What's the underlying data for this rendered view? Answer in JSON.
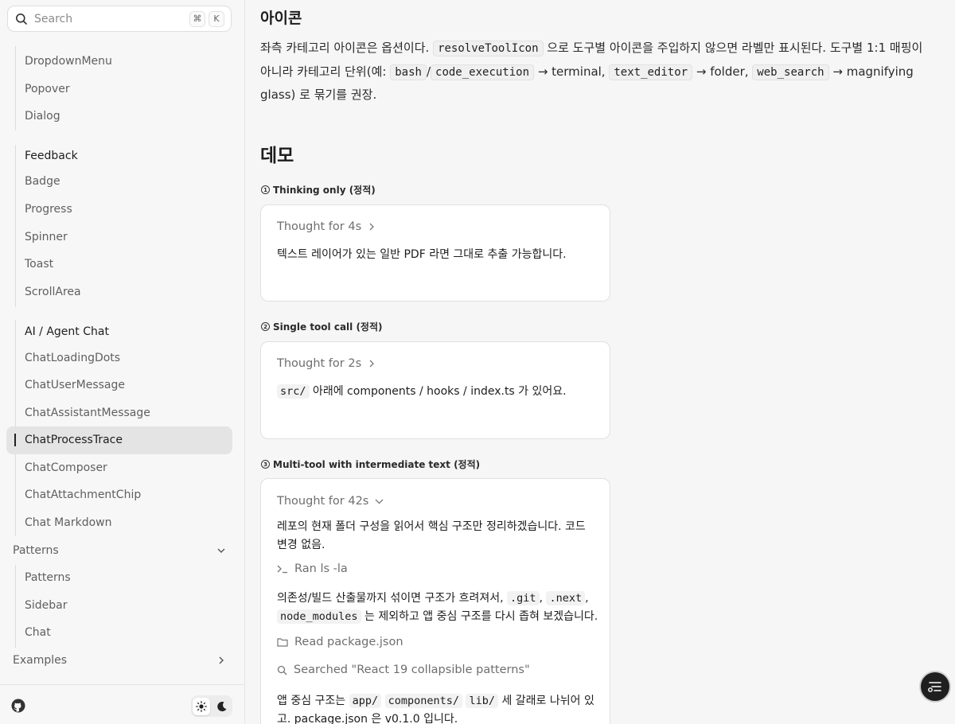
{
  "search": {
    "label": "Search",
    "shortcut_mod": "⌘",
    "shortcut_key": "K"
  },
  "sidebar": {
    "overlays": [
      "DropdownMenu",
      "Popover",
      "Dialog"
    ],
    "feedback_title": "Feedback",
    "feedback": [
      "Badge",
      "Progress",
      "Spinner",
      "Toast",
      "ScrollArea"
    ],
    "ai_title": "AI / Agent Chat",
    "ai": [
      "ChatLoadingDots",
      "ChatUserMessage",
      "ChatAssistantMessage",
      "ChatProcessTrace",
      "ChatComposer",
      "ChatAttachmentChip",
      "Chat Markdown"
    ],
    "patterns_title": "Patterns",
    "patterns": [
      "Patterns",
      "Sidebar",
      "Chat"
    ],
    "examples_title": "Examples"
  },
  "icons_section": {
    "title": "아이콘",
    "p1": "좌측 카테고리 아이콘은 옵션이다.",
    "c1": "resolveToolIcon",
    "p2": "으로 도구별 아이콘을 주입하지 않으면 라벨만 표시된다. 도구별 1:1 매핑이 아니라 카테고리 단위(예:",
    "c2": "bash",
    "slash": "/",
    "c3": "code_execution",
    "p3": "→ terminal,",
    "c4": "text_editor",
    "p4": "→ folder,",
    "c5": "web_search",
    "p5": "→ magnifying glass) 로 묶기를 권장."
  },
  "demo": {
    "title": "데모",
    "d1": {
      "num": "1",
      "label": "Thinking only (정적)",
      "thought": "Thought for 4s",
      "text": "텍스트 레이어가 있는 일반 PDF 라면 그대로 추출 가능합니다."
    },
    "d2": {
      "num": "2",
      "label": "Single tool call (정적)",
      "thought": "Thought for 2s",
      "code": "src/",
      "text": "아래에 components / hooks / index.ts 가 있어요."
    },
    "d3": {
      "num": "3",
      "label": "Multi-tool with intermediate text (정적)",
      "thought": "Thought for 42s",
      "t1": "레포의 현재 폴더 구성을 읽어서 핵심 구조만 정리하겠습니다. 코드 변경 없음.",
      "step1": "Ran ls -la",
      "t2a": "의존성/빌드 산출물까지 섞이면 구조가 흐려져서,",
      "c_git": ".git",
      "comma": ",",
      "c_next": ".next",
      "c_nm": "node_modules",
      "t2b": "는 제외하고 앱 중심 구조를 다시 좁혀 보겠습니다.",
      "step2": "Read package.json",
      "step3": "Searched \"React 19 collapsible patterns\"",
      "t3a": "앱 중심 구조는",
      "c_app": "app/",
      "c_comp": "components/",
      "c_lib": "lib/",
      "t3b": "세 갈래로 나뉘어 있고. package.json 은 v0.1.0 입니다."
    }
  }
}
